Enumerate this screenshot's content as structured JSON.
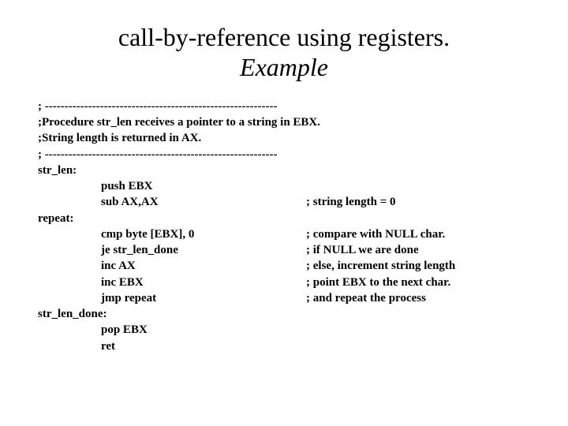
{
  "title": {
    "line1": "call-by-reference using registers.",
    "line2": "Example"
  },
  "comments": {
    "sep1": "; -----------------------------------------------------------",
    "proc": ";Procedure str_len receives a pointer to a string in EBX.",
    "ret": ";String length is returned in AX.",
    "sep2": "; -----------------------------------------------------------"
  },
  "labels": {
    "strlen": "str_len:",
    "repeat": "repeat:",
    "done": "str_len_done:"
  },
  "instr": {
    "push_ebx": "push EBX",
    "sub_ax": "sub AX,AX",
    "cmp_byte": "cmp byte [EBX], 0",
    "je_done": "je str_len_done",
    "inc_ax": "inc AX",
    "inc_ebx": "inc EBX",
    "jmp_repeat": "jmp repeat",
    "pop_ebx": "pop EBX",
    "ret": "ret"
  },
  "linecmt": {
    "sub_ax": "; string length = 0",
    "cmp_byte": "; compare with NULL char.",
    "je_done": "; if NULL we are done",
    "inc_ax": "; else, increment string length",
    "inc_ebx": "; point EBX to the next char.",
    "jmp": "; and repeat the process"
  }
}
